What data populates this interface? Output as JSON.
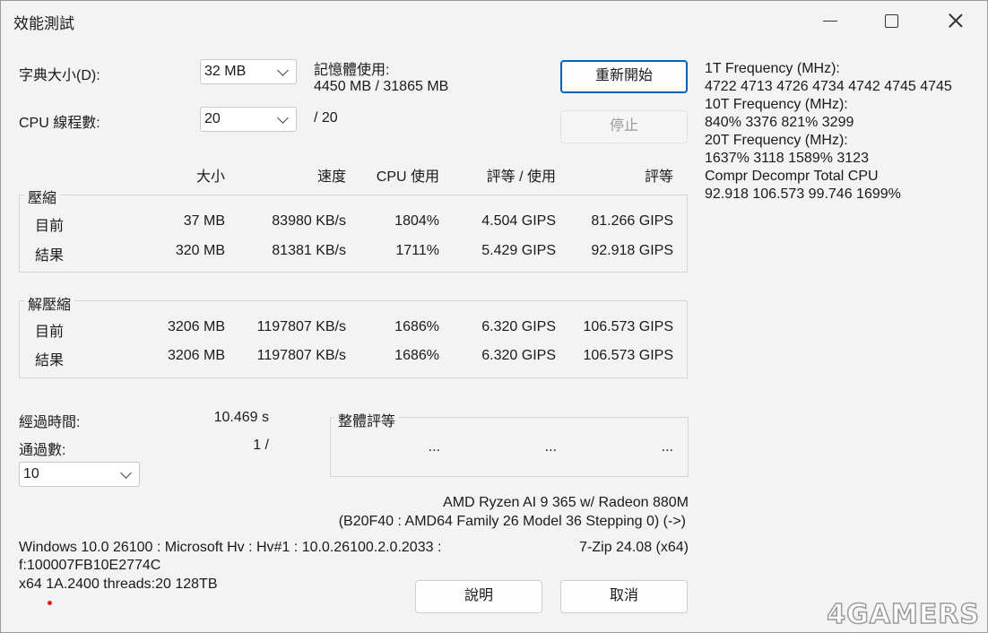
{
  "window": {
    "title": "效能測試"
  },
  "settings": {
    "dict_label": "字典大小(D):",
    "dict_value": "32 MB",
    "threads_label": "CPU 線程數:",
    "threads_value": "20",
    "threads_max": "/ 20",
    "memory_label": "記憶體使用:",
    "memory_value": "4450 MB / 31865 MB"
  },
  "buttons": {
    "restart": "重新開始",
    "stop": "停止",
    "help": "說明",
    "cancel": "取消"
  },
  "table": {
    "headers": [
      "大小",
      "速度",
      "CPU 使用",
      "評等 / 使用",
      "評等"
    ],
    "compress": {
      "label": "壓縮",
      "rows": [
        {
          "name": "目前",
          "size": "37 MB",
          "speed": "83980 KB/s",
          "cpu": "1804%",
          "rating_usage": "4.504 GIPS",
          "rating": "81.266 GIPS"
        },
        {
          "name": "結果",
          "size": "320 MB",
          "speed": "81381 KB/s",
          "cpu": "1711%",
          "rating_usage": "5.429 GIPS",
          "rating": "92.918 GIPS"
        }
      ]
    },
    "decompress": {
      "label": "解壓縮",
      "rows": [
        {
          "name": "目前",
          "size": "3206 MB",
          "speed": "1197807 KB/s",
          "cpu": "1686%",
          "rating_usage": "6.320 GIPS",
          "rating": "106.573 GIPS"
        },
        {
          "name": "結果",
          "size": "3206 MB",
          "speed": "1197807 KB/s",
          "cpu": "1686%",
          "rating_usage": "6.320 GIPS",
          "rating": "106.573 GIPS"
        }
      ]
    }
  },
  "elapsed": {
    "label": "經過時間:",
    "value": "10.469 s"
  },
  "passes": {
    "label": "通過數:",
    "value": "1 /",
    "select_value": "10"
  },
  "overall": {
    "label": "整體評等",
    "values": [
      "...",
      "...",
      "..."
    ]
  },
  "cpu_info": {
    "name": "AMD Ryzen AI 9 365 w/ Radeon 880M",
    "detail": "(B20F40 : AMD64 Family 26 Model 36 Stepping 0) (->)"
  },
  "system": {
    "line1": "Windows 10.0 26100 : Microsoft Hv : Hv#1 : 10.0.26100.2.0.2033 :",
    "line2": "f:100007FB10E2774C",
    "line3": "x64 1A.2400 threads:20 128TB",
    "version": "7-Zip 24.08 (x64)"
  },
  "freq": {
    "l1": "1T Frequency (MHz):",
    "v1": " 4722 4713 4726 4734 4742 4745 4745",
    "l2": "10T Frequency (MHz):",
    "v2": " 840% 3376 821% 3299",
    "l3": "20T Frequency (MHz):",
    "v3": " 1637% 3118 1589% 3123",
    "l4": "Compr Decompr Total   CPU",
    "v4": "92.918  106.573  99.746  1699%"
  },
  "watermark": "4GAMERS"
}
